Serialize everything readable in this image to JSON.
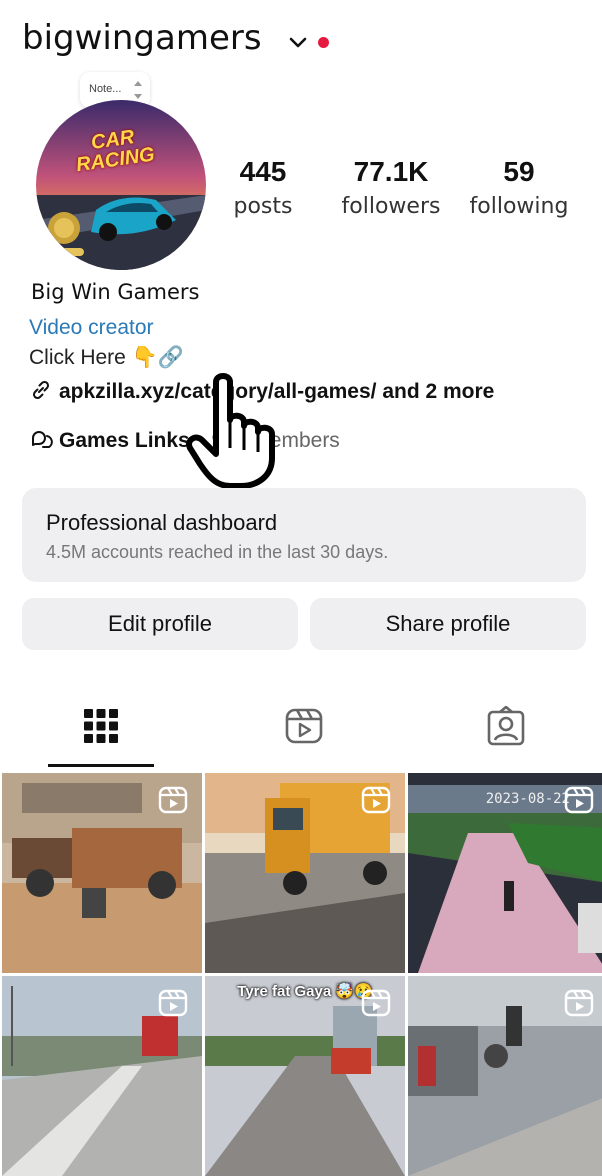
{
  "header": {
    "username": "bigwingamers",
    "accent_dot_color": "#e6193f"
  },
  "note": {
    "label": "Note..."
  },
  "profile": {
    "avatar_text": "CAR RACING",
    "display_name": "Big Win Gamers",
    "category": "Video creator",
    "bio_line": "Click Here 👇🔗",
    "link": "apkzilla.xyz/category/all-games/ and 2 more",
    "channel": {
      "name": "Games Links",
      "members": "984 members"
    }
  },
  "stats": {
    "posts": {
      "value": "445",
      "label": "posts"
    },
    "followers": {
      "value": "77.1K",
      "label": "followers"
    },
    "following": {
      "value": "59",
      "label": "following"
    }
  },
  "dashboard": {
    "title": "Professional dashboard",
    "subtitle": "4.5M accounts reached in the last 30 days."
  },
  "buttons": {
    "edit": "Edit profile",
    "share": "Share profile"
  },
  "tabs": [
    {
      "icon": "grid-icon",
      "active": true
    },
    {
      "icon": "reels-icon",
      "active": false
    },
    {
      "icon": "tagged-icon",
      "active": false
    }
  ],
  "posts": [
    {
      "type": "reel",
      "overlay": ""
    },
    {
      "type": "reel",
      "overlay": ""
    },
    {
      "type": "reel",
      "overlay": "2023-08-22"
    },
    {
      "type": "reel",
      "overlay": ""
    },
    {
      "type": "reel",
      "overlay": "Tyre fat Gaya 🤯😢"
    },
    {
      "type": "reel",
      "overlay": ""
    }
  ]
}
